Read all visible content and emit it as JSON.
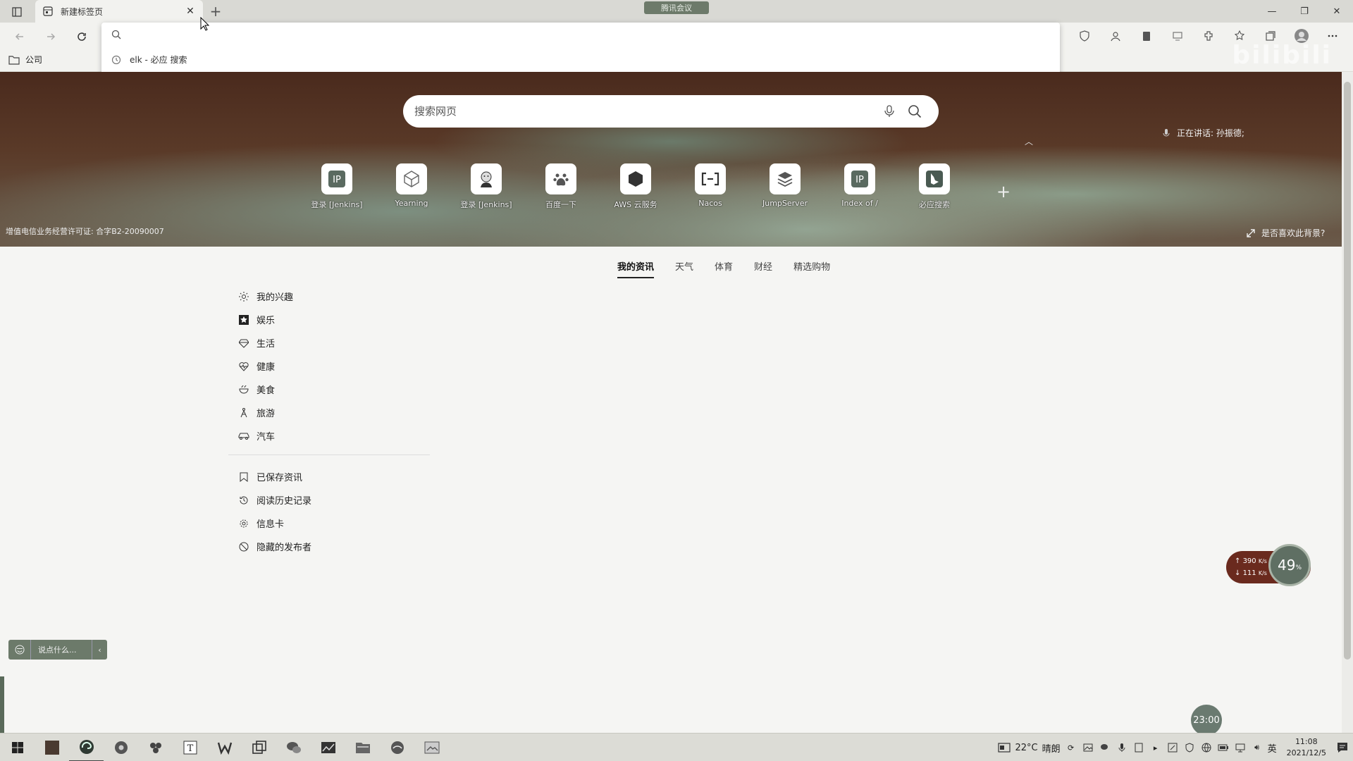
{
  "browser": {
    "tab_title": "新建标签页",
    "new_tab_symbol": "+",
    "meeting_label": "腾讯会议",
    "bookmark_folder": "公司",
    "watermark": "bilibili"
  },
  "omnibox": {
    "suggestion": "elk - 必应 搜索"
  },
  "hero": {
    "search_placeholder": "搜索网页",
    "speaking_text": "正在讲话: 孙振德;",
    "license": "增值电信业务经营许可证: 合字B2-20090007",
    "like_background": "是否喜欢此背景?",
    "tiles": [
      {
        "label": "登录 [Jenkins]",
        "icon": "ip-icon"
      },
      {
        "label": "Yearning",
        "icon": "cube-icon"
      },
      {
        "label": "登录 [Jenkins]",
        "icon": "jenkins-icon"
      },
      {
        "label": "百度一下",
        "icon": "baidu-paw-icon"
      },
      {
        "label": "AWS 云服务",
        "icon": "hexagon-icon"
      },
      {
        "label": "Nacos",
        "icon": "nacos-icon"
      },
      {
        "label": "JumpServer",
        "icon": "layers-icon"
      },
      {
        "label": "Index of /",
        "icon": "ip-icon"
      },
      {
        "label": "必应搜索",
        "icon": "bing-icon"
      }
    ],
    "add_tile": "+"
  },
  "feed": {
    "tabs": [
      "我的资讯",
      "天气",
      "体育",
      "财经",
      "精选购物"
    ],
    "active_tab": 0
  },
  "menu": {
    "top": [
      {
        "label": "我的兴趣",
        "icon": "sun-icon"
      },
      {
        "label": "娱乐",
        "icon": "star-icon"
      },
      {
        "label": "生活",
        "icon": "diamond-icon"
      },
      {
        "label": "健康",
        "icon": "heart-pulse-icon"
      },
      {
        "label": "美食",
        "icon": "bowl-icon"
      },
      {
        "label": "旅游",
        "icon": "traveler-icon"
      },
      {
        "label": "汽车",
        "icon": "car-icon"
      }
    ],
    "bottom": [
      {
        "label": "已保存资讯",
        "icon": "bookmark-icon"
      },
      {
        "label": "阅读历史记录",
        "icon": "history-icon"
      },
      {
        "label": "信息卡",
        "icon": "gear-icon"
      },
      {
        "label": "隐藏的发布者",
        "icon": "block-icon"
      }
    ]
  },
  "chat": {
    "placeholder": "说点什么...",
    "collapse": "‹"
  },
  "net_widget": {
    "upload": "390",
    "upload_unit": "K/s",
    "download": "111",
    "download_unit": "K/s",
    "percent": "49",
    "percent_sign": "%"
  },
  "timer_bubble": "23:00",
  "taskbar": {
    "temperature": "22°C",
    "weather": "晴朗",
    "ime": "英",
    "time": "11:08",
    "date": "2021/12/5"
  },
  "colors": {
    "hero_brown": "#4a2a1d",
    "widget_red": "#6a2a1e",
    "chat_green": "#6c7a6a"
  }
}
